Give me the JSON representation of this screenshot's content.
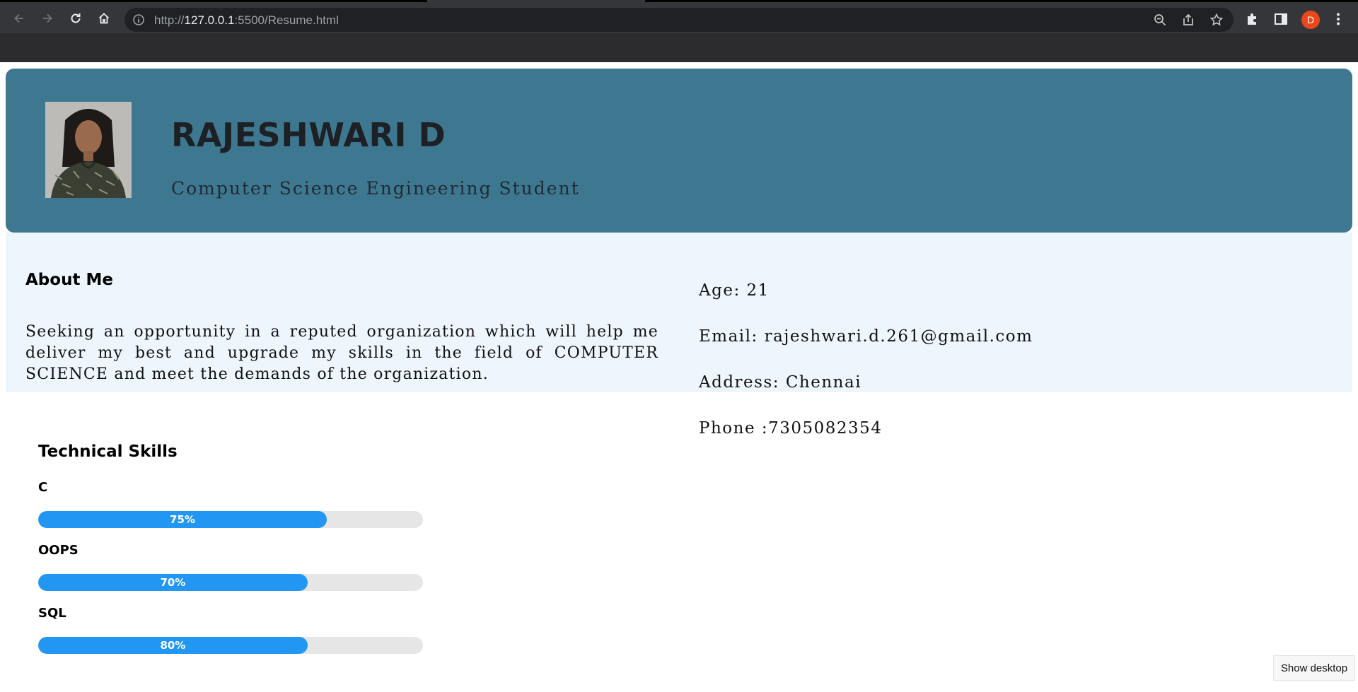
{
  "browser": {
    "url_scheme": "http://",
    "url_host": "127.0.0.1",
    "url_rest": ":5500/Resume.html",
    "profile_initial": "D",
    "accent": "#e8481c",
    "tooltip": "Show desktop"
  },
  "header": {
    "name": "RAJESHWARI D",
    "role": "Computer Science Engineering Student",
    "background": "#3e7890"
  },
  "about": {
    "title": "About Me",
    "text": "Seeking an opportunity in a reputed organization which will help me deliver my best and upgrade my skills in the field of COMPUTER SCIENCE and meet the demands of the organization."
  },
  "contact": {
    "age": "Age: 21",
    "email": "Email: rajeshwari.d.261@gmail.com",
    "address": "Address: Chennai",
    "phone": "Phone :7305082354"
  },
  "skills": {
    "title": "Technical Skills",
    "bar_color": "#2196f3",
    "items": [
      {
        "label": "C",
        "percent_text": "75%",
        "fill": 0.75
      },
      {
        "label": "OOPS",
        "percent_text": "70%",
        "fill": 0.7
      },
      {
        "label": "SQL",
        "percent_text": "80%",
        "fill": 0.7
      }
    ]
  }
}
